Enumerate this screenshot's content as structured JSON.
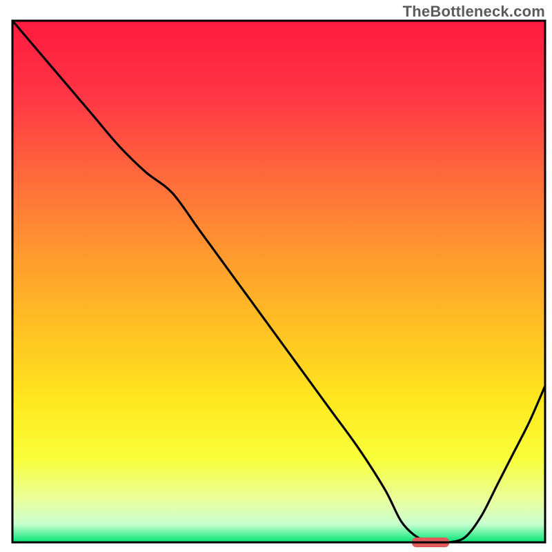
{
  "watermark": "TheBottleneck.com",
  "colors": {
    "gradient_stops": [
      {
        "offset": 0.0,
        "color": "#ff1a3f"
      },
      {
        "offset": 0.15,
        "color": "#ff3746"
      },
      {
        "offset": 0.3,
        "color": "#ff6a3c"
      },
      {
        "offset": 0.45,
        "color": "#ff9a2e"
      },
      {
        "offset": 0.6,
        "color": "#ffc423"
      },
      {
        "offset": 0.73,
        "color": "#ffe81f"
      },
      {
        "offset": 0.84,
        "color": "#f8ff3a"
      },
      {
        "offset": 0.92,
        "color": "#e9ffa0"
      },
      {
        "offset": 0.965,
        "color": "#c9ffcf"
      },
      {
        "offset": 1.0,
        "color": "#00e676"
      }
    ],
    "frame": "#000000",
    "curve": "#000000",
    "marker": "#e05a5a"
  },
  "chart_data": {
    "type": "line",
    "title": "",
    "xlabel": "",
    "ylabel": "",
    "xlim": [
      0,
      100
    ],
    "ylim": [
      0,
      100
    ],
    "legend": false,
    "grid": false,
    "series": [
      {
        "name": "bottleneck-curve",
        "x": [
          0,
          5,
          10,
          15,
          20,
          25,
          30,
          35,
          40,
          45,
          50,
          55,
          60,
          65,
          70,
          73,
          76,
          79,
          82,
          85,
          88,
          91,
          94,
          97,
          100
        ],
        "y": [
          100,
          94,
          88,
          82,
          76,
          71,
          67,
          60,
          53,
          46,
          39,
          32,
          25,
          18,
          10,
          4,
          1,
          0,
          0,
          1,
          5,
          11,
          17,
          23,
          30
        ]
      }
    ],
    "marker": {
      "name": "optimal-range",
      "x_start": 75,
      "x_end": 82,
      "y": 0
    },
    "annotations": [
      {
        "text": "TheBottleneck.com",
        "position": "top-right"
      }
    ]
  }
}
